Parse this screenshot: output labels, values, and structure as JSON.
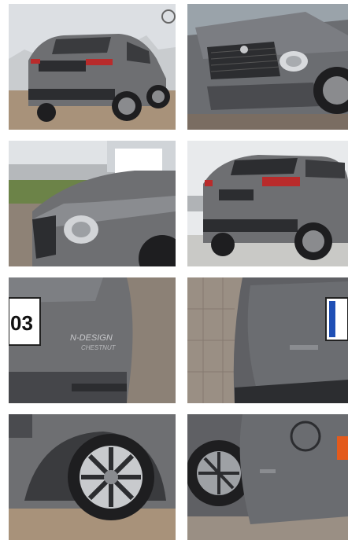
{
  "gallery": {
    "photos": [
      {
        "id": "rear-three-quarter"
      },
      {
        "id": "front-grille-headlight"
      },
      {
        "id": "front-side-headlight"
      },
      {
        "id": "rear-three-quarter-parked"
      },
      {
        "id": "rear-badge-closeup"
      },
      {
        "id": "rear-bumper-closeup"
      },
      {
        "id": "wheel-closeup"
      },
      {
        "id": "door-panel-closeup"
      }
    ],
    "labels": {
      "plate_rear": "03",
      "badge_line1": "N-DESIGN",
      "badge_line2": "CHESTNUT"
    },
    "colors": {
      "car_body": "#6e6f72",
      "car_dark": "#2c2d30",
      "sky": "#dcdfe3",
      "pavement": "#8e8276",
      "accent_orange": "#e35a1c"
    }
  }
}
